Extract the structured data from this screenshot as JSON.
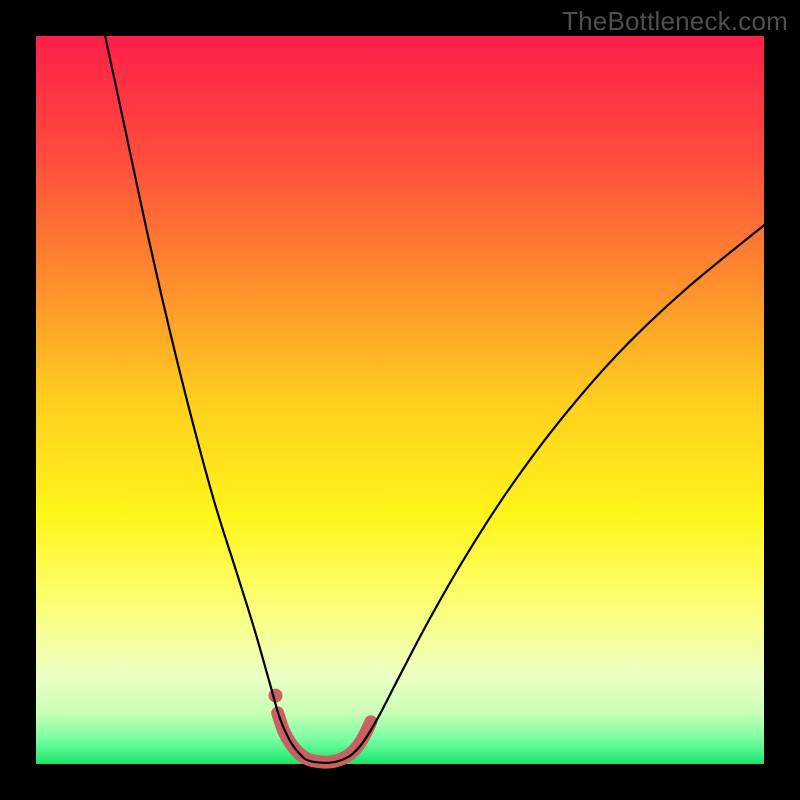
{
  "watermark": "TheBottleneck.com",
  "chart_data": {
    "type": "line",
    "title": "",
    "xlabel": "",
    "ylabel": "",
    "xlim": [
      0,
      100
    ],
    "ylim": [
      0,
      100
    ],
    "grid": false,
    "gradient_stops": [
      {
        "offset": 0.0,
        "color": "#ff1f4a"
      },
      {
        "offset": 0.16,
        "color": "#ff4a3e"
      },
      {
        "offset": 0.33,
        "color": "#ff8a2e"
      },
      {
        "offset": 0.5,
        "color": "#ffce1e"
      },
      {
        "offset": 0.66,
        "color": "#fff61a"
      },
      {
        "offset": 0.78,
        "color": "#fcff75"
      },
      {
        "offset": 0.88,
        "color": "#edffc4"
      },
      {
        "offset": 0.93,
        "color": "#c9ffb6"
      },
      {
        "offset": 0.965,
        "color": "#7bffa3"
      },
      {
        "offset": 1.0,
        "color": "#19e66a"
      }
    ],
    "series": [
      {
        "name": "bottleneck-curve",
        "color": "#000000",
        "width": 2.2,
        "points": [
          {
            "x": 9.5,
            "y": 100.0
          },
          {
            "x": 12.5,
            "y": 86.0
          },
          {
            "x": 15.5,
            "y": 72.0
          },
          {
            "x": 18.5,
            "y": 59.0
          },
          {
            "x": 21.5,
            "y": 47.0
          },
          {
            "x": 24.5,
            "y": 36.0
          },
          {
            "x": 27.5,
            "y": 26.5
          },
          {
            "x": 30.0,
            "y": 18.5
          },
          {
            "x": 32.0,
            "y": 11.5
          },
          {
            "x": 33.5,
            "y": 6.3
          },
          {
            "x": 35.0,
            "y": 3.0
          },
          {
            "x": 36.5,
            "y": 1.1
          },
          {
            "x": 37.5,
            "y": 0.45
          },
          {
            "x": 39.0,
            "y": 0.2
          },
          {
            "x": 40.5,
            "y": 0.2
          },
          {
            "x": 42.0,
            "y": 0.55
          },
          {
            "x": 43.5,
            "y": 1.4
          },
          {
            "x": 45.0,
            "y": 3.1
          },
          {
            "x": 47.0,
            "y": 6.4
          },
          {
            "x": 50.0,
            "y": 12.2
          },
          {
            "x": 54.0,
            "y": 19.8
          },
          {
            "x": 59.0,
            "y": 28.5
          },
          {
            "x": 65.0,
            "y": 37.8
          },
          {
            "x": 72.0,
            "y": 47.2
          },
          {
            "x": 80.0,
            "y": 56.4
          },
          {
            "x": 89.0,
            "y": 65.0
          },
          {
            "x": 100.0,
            "y": 74.0
          }
        ]
      },
      {
        "name": "valley-marker",
        "color": "#c96061",
        "width": 13,
        "linecap": "round",
        "points": [
          {
            "x": 33.2,
            "y": 7.0
          },
          {
            "x": 34.0,
            "y": 4.6
          },
          {
            "x": 35.0,
            "y": 2.8
          },
          {
            "x": 36.2,
            "y": 1.4
          },
          {
            "x": 37.5,
            "y": 0.6
          },
          {
            "x": 39.0,
            "y": 0.3
          },
          {
            "x": 40.5,
            "y": 0.3
          },
          {
            "x": 42.0,
            "y": 0.7
          },
          {
            "x": 43.3,
            "y": 1.5
          },
          {
            "x": 44.3,
            "y": 2.6
          },
          {
            "x": 45.2,
            "y": 4.1
          },
          {
            "x": 46.0,
            "y": 5.8
          }
        ]
      },
      {
        "name": "marker-dot",
        "type_hint": "scatter",
        "color": "#c96061",
        "radius": 7,
        "points": [
          {
            "x": 32.9,
            "y": 9.4
          }
        ]
      }
    ]
  }
}
